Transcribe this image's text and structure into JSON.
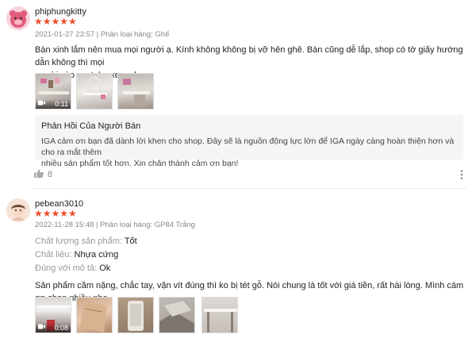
{
  "reviews": [
    {
      "username": "phiphungkitty",
      "stars": "★★★★★",
      "meta": "2021-01-27 23:57 | Phân loại hàng: Ghế",
      "text_line1": "Bàn xinh lắm nên mua mọi người ạ. Kính không không bị vỡ hên ghê. Bàn cũng dễ lắp, shop có tờ giấy hướng dẫn không thì mọi",
      "text_line2": "người vào youtube xem nha",
      "media_duration": "0:11",
      "seller_reply_title": "Phản Hồi Của Người Bán",
      "seller_reply_line1": "IGA cảm ơn bạn đã dành lời khen cho shop. Đây sẽ là nguồn động lực lớn để IGA ngày càng hoàn thiện hơn và cho ra mắt thêm",
      "seller_reply_line2": "nhiều sản phẩm tốt hơn. Xin chân thành cảm ơn bạn!",
      "likes": "8"
    },
    {
      "username": "pebean3010",
      "stars": "★★★★★",
      "meta": "2022-11-28 15:48 | Phân loại hàng: GP84 Trắng",
      "attributes": [
        {
          "key": "Chất lượng sản phẩm:",
          "value": "Tốt"
        },
        {
          "key": "Chất liệu:",
          "value": "Nhựa cứng"
        },
        {
          "key": "Đúng với mô tả:",
          "value": "Ok"
        }
      ],
      "text": "Sản phẩm cầm nặng, chắc tay, vặn vít đúng thì ko bị tét gỗ. Nói chung là tốt với giá tiền, rất hài lòng. Mình cám ơn shop nhiều nha",
      "media_duration": "0:08"
    }
  ],
  "colors": {
    "star": "#ee4d2d",
    "muted": "#888888",
    "reply_bg": "#f5f5f5"
  },
  "icons": {
    "like": "thumbs-up-icon",
    "more": "more-vertical-icon",
    "video": "video-camera-icon"
  }
}
